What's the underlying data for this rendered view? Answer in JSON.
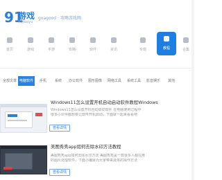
{
  "header": {
    "logo_nine": "91",
    "logo_text": "游戏",
    "logo_sub": "91jiaoyu",
    "slogan": "goagood · 攻略游戏网"
  },
  "nav": {
    "items": [
      {
        "label": "首页"
      },
      {
        "label": "游戏"
      },
      {
        "label": "手游"
      },
      {
        "label": "攻略"
      },
      {
        "label": "软件"
      },
      {
        "label": "资讯"
      },
      {
        "label": "专题"
      },
      {
        "label": "教程",
        "active": true
      },
      {
        "label": "合集"
      }
    ]
  },
  "tabs": [
    {
      "label": "全部文章"
    },
    {
      "label": "电脑软件",
      "active": true
    },
    {
      "label": "手机"
    },
    {
      "label": "系统"
    },
    {
      "label": "办公软件"
    },
    {
      "label": "图形图像"
    },
    {
      "label": "网络工具"
    },
    {
      "label": "系统工具"
    },
    {
      "label": "影音娱乐"
    },
    {
      "label": "其他"
    }
  ],
  "articles": [
    {
      "title": "Windows11怎么设置开机自动启动软件教程Windows",
      "desc1": "Windows11怎么设置开机自动启动软件 在电脑使用过程中",
      "desc2": "很多小伙伴都想要让软件开机启动，下面就一起来看看吧",
      "button": "查看详情"
    },
    {
      "title": "美图秀秀app如何去除水印方法教程",
      "desc1": "美图秀秀app如何去除水印方法 美图秀秀是一款很多人都在用",
      "desc2": "的图片处理软件，下面小编就为大家带来具体的操作方法",
      "button": "查看详情"
    }
  ]
}
